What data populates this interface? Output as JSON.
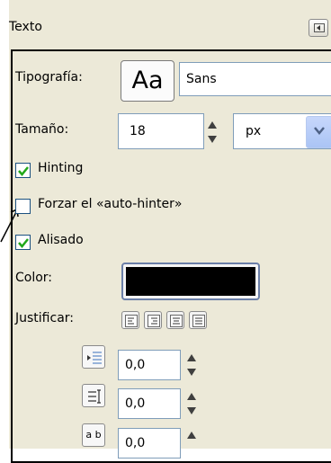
{
  "panel": {
    "title": "Texto"
  },
  "font": {
    "label": "Tipografía:",
    "preview": "Aa",
    "name": "Sans"
  },
  "size": {
    "label": "Tamaño:",
    "value": "18",
    "unit": "px"
  },
  "options": {
    "hinting": {
      "label": "Hinting",
      "checked": true
    },
    "autohinter": {
      "label": "Forzar el «auto-hinter»",
      "checked": false
    },
    "antialias": {
      "label": "Alisado",
      "checked": true
    }
  },
  "color": {
    "label": "Color:",
    "value": "#000000"
  },
  "justify": {
    "label": "Justificar:"
  },
  "indent": {
    "value": "0,0"
  },
  "line_spacing": {
    "value": "0,0"
  },
  "letter_spacing": {
    "value": "0,0",
    "icon_text": "a b"
  },
  "colors": {
    "panel_bg": "#ECE9D8",
    "check": "#22a81a",
    "border": "#7f9db9"
  },
  "icons": [
    "panel-menu-icon",
    "spin-arrows-icon",
    "chevron-down-icon",
    "checkmark-icon",
    "align-left-icon",
    "align-right-icon",
    "align-center-icon",
    "align-fill-icon",
    "indent-icon",
    "line-spacing-icon",
    "letter-spacing-icon",
    "annotation-arrow"
  ]
}
